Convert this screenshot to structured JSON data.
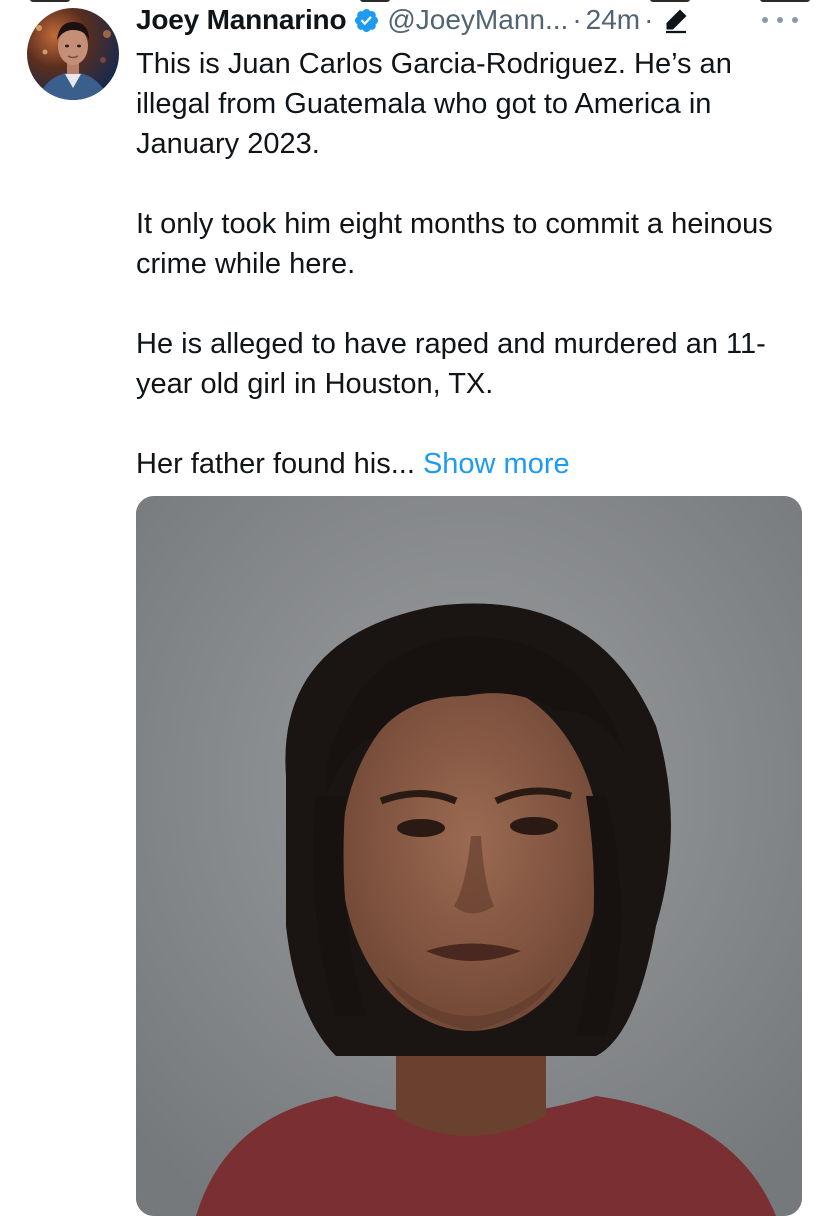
{
  "tweet": {
    "author": {
      "display_name": "Joey Mannarino",
      "handle": "@JoeyMann...",
      "verified": true
    },
    "separator": "·",
    "timestamp": "24m",
    "text": {
      "paragraph_1": "This is Juan Carlos Garcia-Rodriguez. He’s an illegal from Guatemala who got to America in January 2023.",
      "paragraph_2": "It only took him eight months to commit a heinous crime while here.",
      "paragraph_3": "He is alleged to have raped and murdered an 11-year old girl in Houston, TX.",
      "paragraph_4": "Her father found his...",
      "show_more_label": "Show more"
    },
    "icons": {
      "verified": "verified-badge-icon",
      "edit": "pencil-icon",
      "more": "more-options-icon"
    }
  },
  "colors": {
    "text_primary": "#0f1419",
    "text_secondary": "#536471",
    "link": "#1d9bf0",
    "verified_badge": "#1d9bf0"
  }
}
